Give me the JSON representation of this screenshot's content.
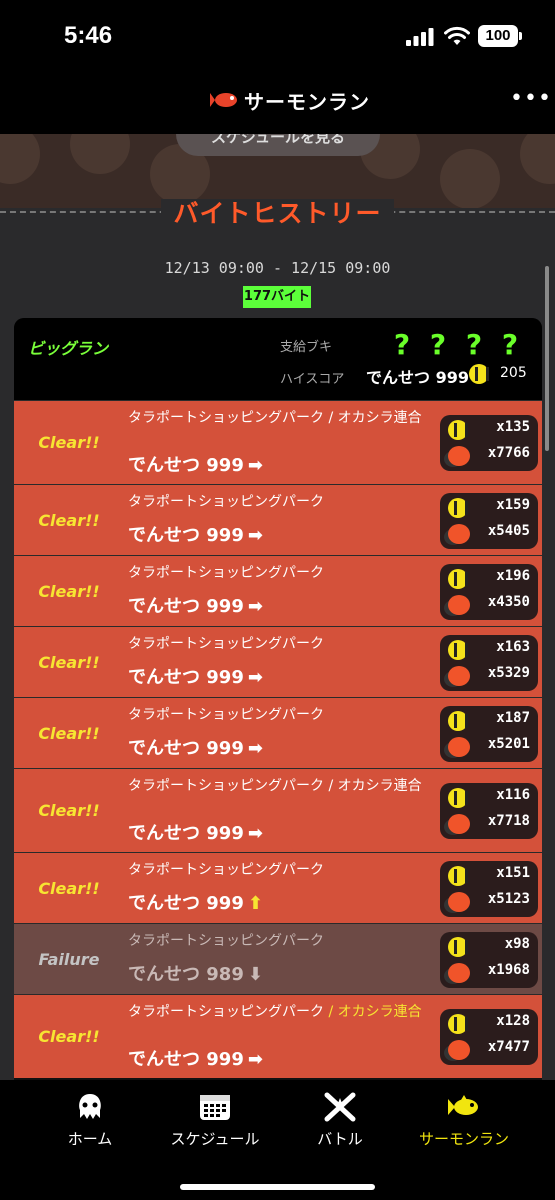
{
  "status_bar": {
    "time": "5:46",
    "battery": "100"
  },
  "nav": {
    "title": "サーモンラン"
  },
  "schedule_button": "スケジュールを見る",
  "section_title": "バイトヒストリー",
  "date_range": "12/13 09:00 - 12/15 09:00",
  "shift_count": "177バイト",
  "card": {
    "mode": "ビッグラン",
    "weapons_label": "支給ブキ",
    "weapons": [
      "?",
      "?",
      "?",
      "?"
    ],
    "hiscore_label": "ハイスコア",
    "hiscore_rank": "でんせつ 999",
    "hiscore_eggs": "205"
  },
  "rows": [
    {
      "result": "Clear!!",
      "stage": "タラポートショッピングパーク",
      "boss": " / オカシラ連合",
      "rank": "でんせつ 999",
      "trend": "➡",
      "golden": "x135",
      "power": "x7766"
    },
    {
      "result": "Clear!!",
      "stage": "タラポートショッピングパーク",
      "boss": "",
      "rank": "でんせつ 999",
      "trend": "➡",
      "golden": "x159",
      "power": "x5405"
    },
    {
      "result": "Clear!!",
      "stage": "タラポートショッピングパーク",
      "boss": "",
      "rank": "でんせつ 999",
      "trend": "➡",
      "golden": "x196",
      "power": "x4350"
    },
    {
      "result": "Clear!!",
      "stage": "タラポートショッピングパーク",
      "boss": "",
      "rank": "でんせつ 999",
      "trend": "➡",
      "golden": "x163",
      "power": "x5329"
    },
    {
      "result": "Clear!!",
      "stage": "タラポートショッピングパーク",
      "boss": "",
      "rank": "でんせつ 999",
      "trend": "➡",
      "golden": "x187",
      "power": "x5201"
    },
    {
      "result": "Clear!!",
      "stage": "タラポートショッピングパーク",
      "boss": " / オカシラ連合",
      "rank": "でんせつ 999",
      "trend": "➡",
      "golden": "x116",
      "power": "x7718"
    },
    {
      "result": "Clear!!",
      "stage": "タラポートショッピングパーク",
      "boss": "",
      "rank": "でんせつ 999",
      "trend": "⬆",
      "golden": "x151",
      "power": "x5123"
    },
    {
      "result": "Failure",
      "stage": "タラポートショッピングパーク",
      "boss": "",
      "rank": "でんせつ 989",
      "trend": "⬇",
      "golden": "x98",
      "power": "x1968"
    },
    {
      "result": "Clear!!",
      "stage": "タラポートショッピングパーク",
      "boss": " / オカシラ連合",
      "rank": "でんせつ 999",
      "trend": "➡",
      "golden": "x128",
      "power": "x7477"
    }
  ],
  "tabs": [
    {
      "label": "ホーム",
      "icon": "squid-icon"
    },
    {
      "label": "スケジュール",
      "icon": "calendar-icon"
    },
    {
      "label": "バトル",
      "icon": "battle-icon"
    },
    {
      "label": "サーモンラン",
      "icon": "salmon-icon"
    }
  ],
  "colors": {
    "clear_row": "#d4513a",
    "failure_row": "#6d4a45",
    "accent_yellow": "#f7e532",
    "title_orange": "#ff5a2a",
    "green": "#5cff3a"
  }
}
